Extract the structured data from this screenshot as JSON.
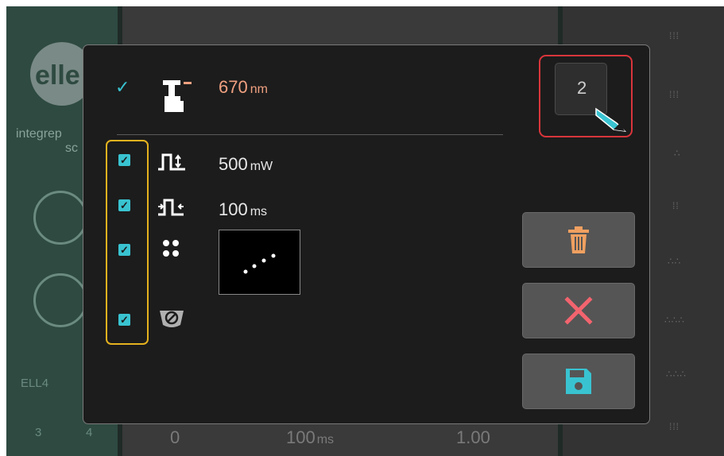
{
  "laser": {
    "wavelength_value": "670",
    "wavelength_unit": "nm"
  },
  "treatment_number": {
    "value": "2"
  },
  "parameters": {
    "power": {
      "value": "500",
      "unit": "mW"
    },
    "duration": {
      "value": "100",
      "unit": "ms"
    }
  },
  "background": {
    "brand_text_1": "integrep",
    "brand_text_2": "sc",
    "chip_a": "ELL4",
    "chip_b": "3",
    "chip_c": "4",
    "bottom_left_value": "0",
    "bottom_mid_value": "100",
    "bottom_mid_unit": "ms",
    "bottom_right_value": "1.00"
  },
  "checkboxes": {
    "power": true,
    "duration": true,
    "pattern": true,
    "aiming": true
  },
  "colors": {
    "accent_cyan": "#39c3d1",
    "wavelength_orange": "#f0a080",
    "highlight_yellow": "#e5b21e",
    "highlight_red": "#d9353b",
    "delete_orange": "#f0a060",
    "cancel_red": "#f2646e"
  },
  "icons": {
    "laser": "laser-source-icon",
    "power": "pulse-power-icon",
    "duration": "pulse-duration-icon",
    "pattern": "spot-pattern-icon",
    "aiming": "aiming-beam-off-icon",
    "delete": "trash-icon",
    "cancel": "close-icon",
    "save": "save-icon",
    "edit": "pencil-icon"
  }
}
